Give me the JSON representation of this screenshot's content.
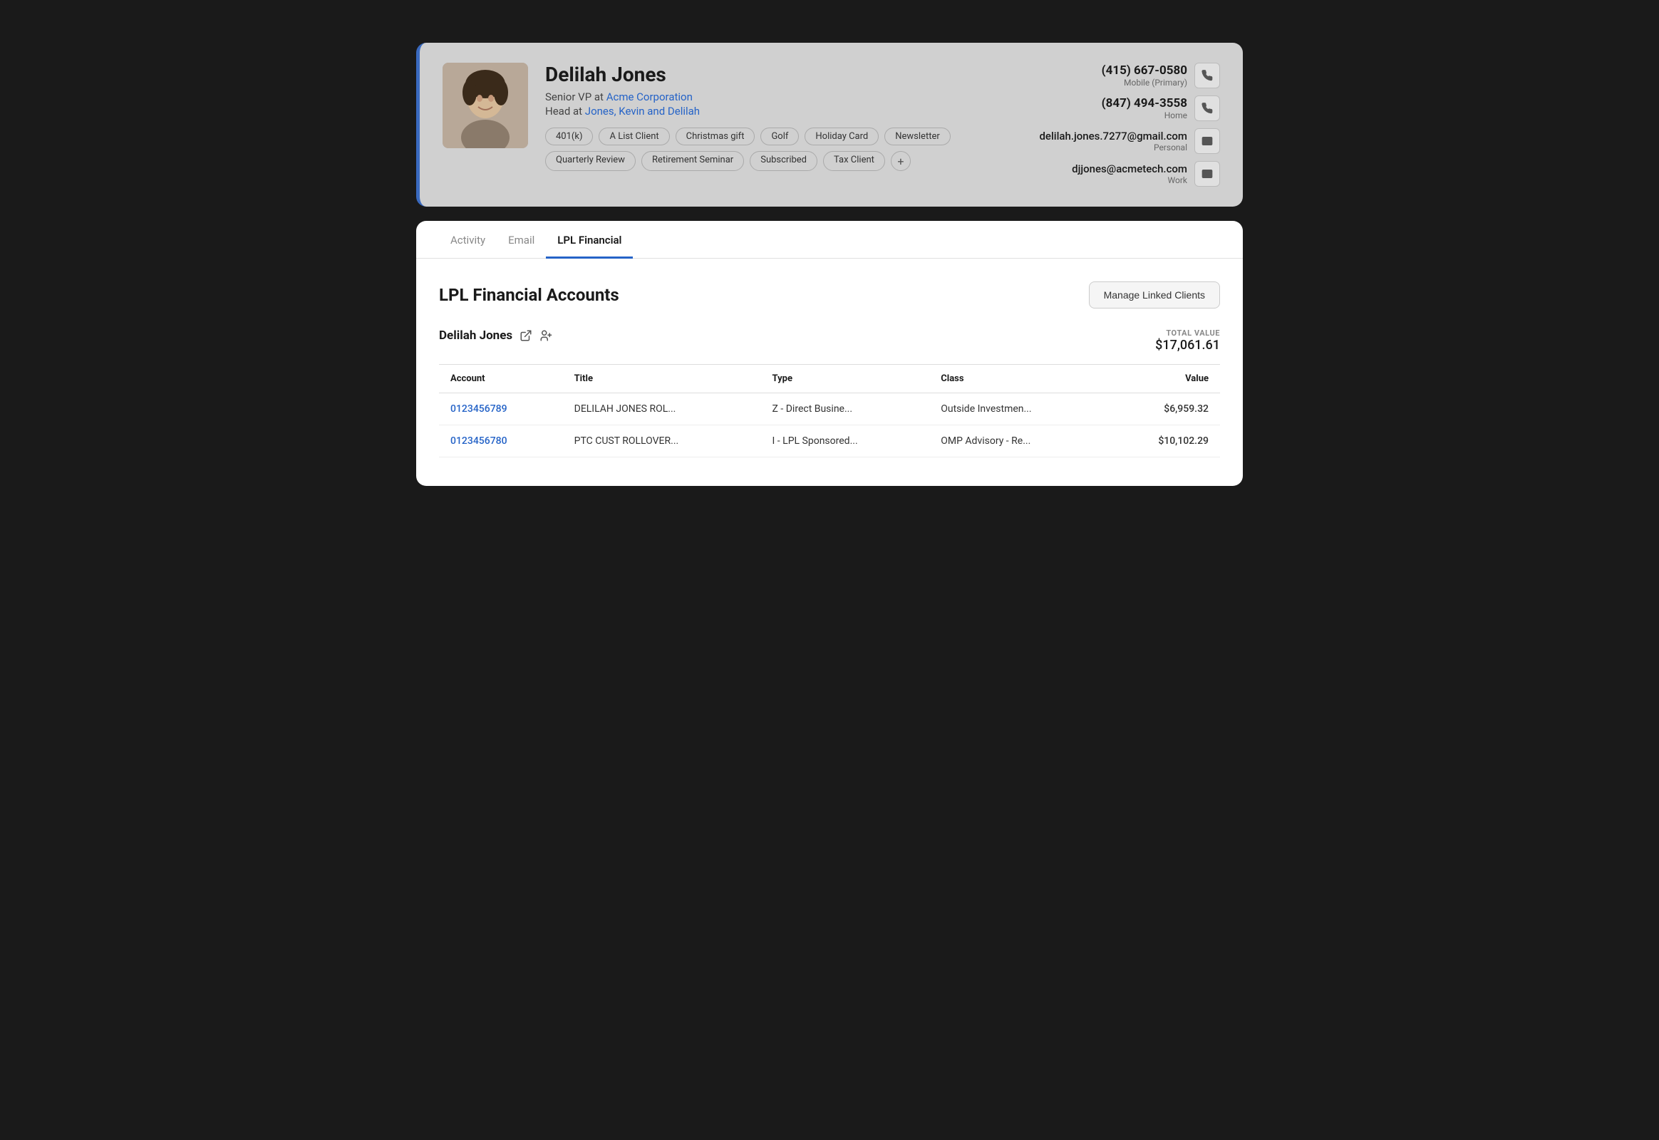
{
  "profile": {
    "name": "Delilah Jones",
    "title_prefix": "Senior VP at",
    "company1": "Acme Corporation",
    "company1_link": "#",
    "title2_prefix": "Head at",
    "company2": "Jones, Kevin and Delilah",
    "company2_link": "#",
    "tags": [
      "401(k)",
      "A List Client",
      "Christmas gift",
      "Golf",
      "Holiday Card",
      "Newsletter",
      "Quarterly Review",
      "Retirement Seminar",
      "Subscribed",
      "Tax Client"
    ],
    "contacts": [
      {
        "value": "(415) 667-0580",
        "label": "Mobile (Primary)",
        "type": "phone"
      },
      {
        "value": "(847) 494-3558",
        "label": "Home",
        "type": "phone"
      },
      {
        "value": "delilah.jones.7277@gmail.com",
        "label": "Personal",
        "type": "email"
      },
      {
        "value": "djjones@acmetech.com",
        "label": "Work",
        "type": "email"
      }
    ]
  },
  "tabs": [
    "Activity",
    "Email",
    "LPL Financial"
  ],
  "active_tab": "LPL Financial",
  "lpl": {
    "section_title": "LPL Financial Accounts",
    "manage_btn_label": "Manage Linked Clients",
    "client_name": "Delilah Jones",
    "total_label": "TOTAL VALUE",
    "total_value": "$17,061.61",
    "table_headers": [
      "Account",
      "Title",
      "Type",
      "Class",
      "Value"
    ],
    "rows": [
      {
        "account": "0123456789",
        "title": "DELILAH JONES ROL...",
        "type": "Z - Direct Busine...",
        "class": "Outside Investmen...",
        "value": "$6,959.32"
      },
      {
        "account": "0123456780",
        "title": "PTC CUST ROLLOVER...",
        "type": "I - LPL Sponsored...",
        "class": "OMP Advisory - Re...",
        "value": "$10,102.29"
      }
    ]
  }
}
